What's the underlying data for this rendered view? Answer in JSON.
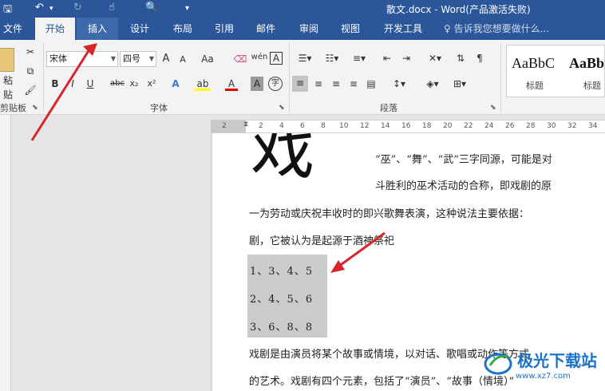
{
  "titlebar": {
    "save_icon": "save-icon",
    "undo_icon": "undo-icon",
    "redo_icon": "redo-icon",
    "touch_icon": "touch-mode-icon",
    "preview_icon": "print-preview-icon",
    "customize_icon": "customize-qat-icon",
    "title": "散文.docx - Word(产品激活失败)"
  },
  "tabs": [
    {
      "label": "文件"
    },
    {
      "label": "开始"
    },
    {
      "label": "插入"
    },
    {
      "label": "设计"
    },
    {
      "label": "布局"
    },
    {
      "label": "引用"
    },
    {
      "label": "邮件"
    },
    {
      "label": "审阅"
    },
    {
      "label": "视图"
    },
    {
      "label": "开发工具"
    }
  ],
  "tellme": "♀ 告诉我您想要做什么...",
  "ribbon": {
    "clipboard": {
      "paste_label": "粘贴",
      "group_label": "剪贴板"
    },
    "font": {
      "font_name": "宋体",
      "font_size": "四号",
      "group_label": "字体",
      "bold": "B",
      "italic": "I",
      "underline": "U",
      "strike": "abc",
      "sub": "x₂",
      "sup": "x²",
      "case": "Aa",
      "grow": "A",
      "shrink": "A",
      "phonetic": "wén",
      "border_char": "A",
      "shading_char": "A",
      "enclose": "字",
      "text_effect": "A",
      "highlight": "ab",
      "font_color": "A"
    },
    "paragraph": {
      "group_label": "段落"
    },
    "styles": [
      {
        "sample": "AaBbC",
        "name": "标题"
      },
      {
        "sample": "AaBb",
        "name": "标题"
      }
    ]
  },
  "ruler": {
    "marks": [
      "2",
      "2",
      "4",
      "6",
      "8",
      "10",
      "12",
      "14",
      "16",
      "18",
      "20",
      "22",
      "24",
      "26",
      "28",
      "30",
      "32",
      "34"
    ]
  },
  "document": {
    "dropcap": "戏",
    "lines": [
      "“巫”、“舞”、“武”三字同源，可能是对",
      "斗胜利的巫术活动的合称，即戏剧的原",
      "一为劳动或庆祝丰收时的即兴歌舞表演，这种说法主要依据：",
      "剧，它被认为是起源于酒神祭祀"
    ],
    "highlighted_lines": [
      "1、3、4、5",
      "2、4、5、6",
      "3、6、8、8"
    ],
    "after_lines": [
      "戏剧是由演员将某个故事或情境，以对话、歌唱或动作等方式",
      "的艺术。戏剧有四个元素，包括了“演员”、“故事（情境）”"
    ]
  },
  "watermark": {
    "name": "极光下载站",
    "url": "www.xz7.com"
  },
  "colors": {
    "accent": "#2b579a",
    "arrow": "#d7262b",
    "highlight": "#cbcbcb"
  }
}
